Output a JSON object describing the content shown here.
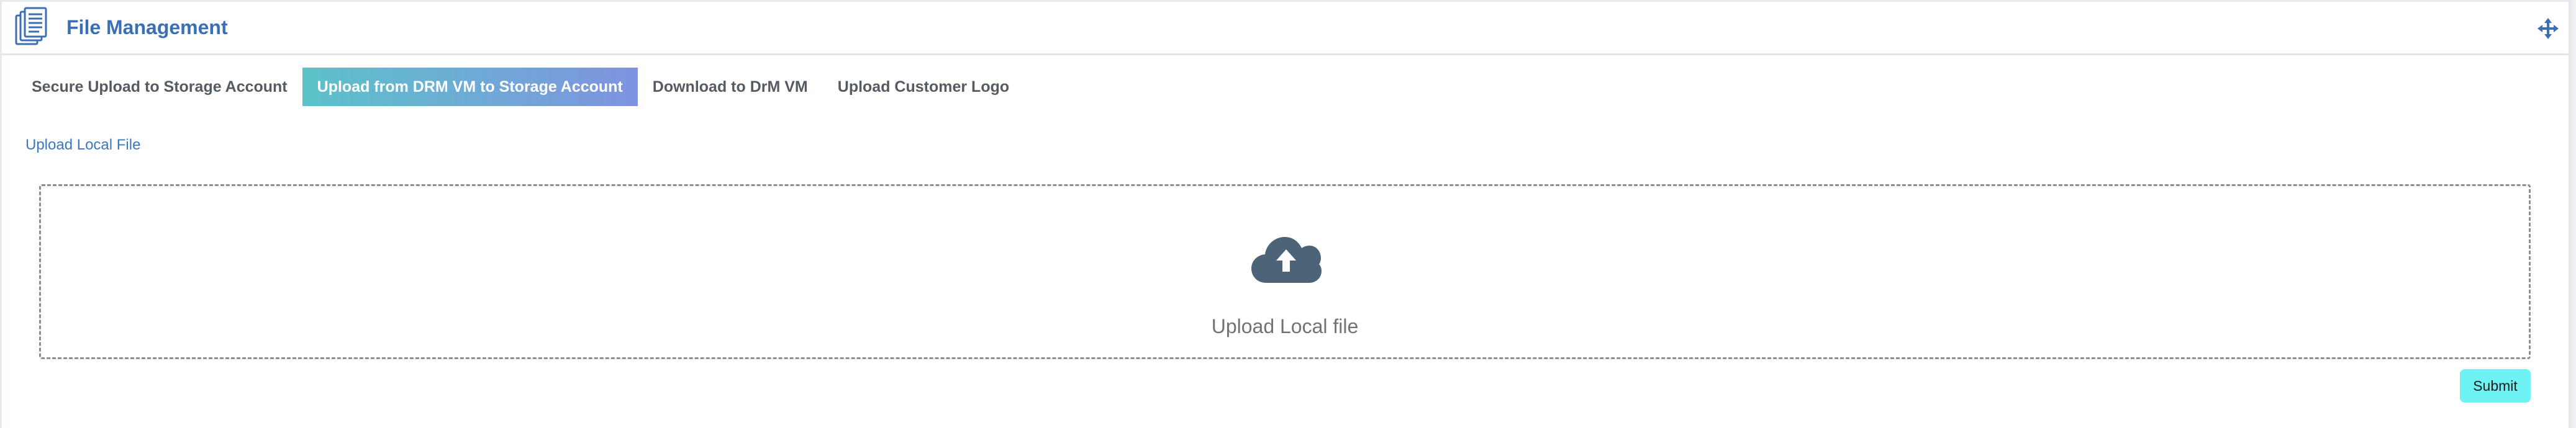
{
  "header": {
    "title": "File Management",
    "icon": "documents-icon",
    "move_icon": "move-arrows-icon",
    "accent_color": "#3a6fb5"
  },
  "tabs": [
    {
      "label": "Secure Upload to Storage Account",
      "active": false
    },
    {
      "label": "Upload from DRM VM to Storage Account",
      "active": true
    },
    {
      "label": "Download to DrM VM",
      "active": false
    },
    {
      "label": "Upload Customer Logo",
      "active": false
    }
  ],
  "upload": {
    "section_label": "Upload Local File",
    "dropzone_text": "Upload Local file",
    "icon": "cloud-upload-icon"
  },
  "actions": {
    "submit_label": "Submit",
    "submit_color": "#6ff2f4"
  }
}
